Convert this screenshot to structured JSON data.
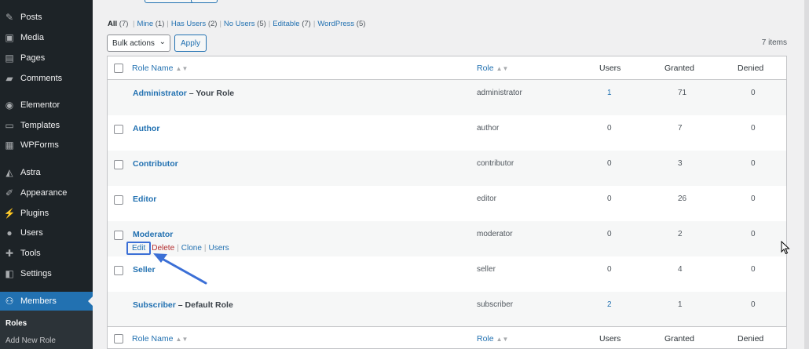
{
  "sidebar": {
    "items": [
      {
        "label": "Posts",
        "icon": "pushpin-icon",
        "glyph": "✎"
      },
      {
        "label": "Media",
        "icon": "media-icon",
        "glyph": "▣"
      },
      {
        "label": "Pages",
        "icon": "pages-icon",
        "glyph": "▤"
      },
      {
        "label": "Comments",
        "icon": "comment-icon",
        "glyph": "▰"
      },
      {
        "label": "Elementor",
        "icon": "elementor-icon",
        "glyph": "◉"
      },
      {
        "label": "Templates",
        "icon": "folder-icon",
        "glyph": "▭"
      },
      {
        "label": "WPForms",
        "icon": "wpforms-icon",
        "glyph": "▦"
      },
      {
        "label": "Astra",
        "icon": "astra-icon",
        "glyph": "◭"
      },
      {
        "label": "Appearance",
        "icon": "brush-icon",
        "glyph": "✐"
      },
      {
        "label": "Plugins",
        "icon": "plug-icon",
        "glyph": "⚡"
      },
      {
        "label": "Users",
        "icon": "user-icon",
        "glyph": "●"
      },
      {
        "label": "Tools",
        "icon": "wrench-icon",
        "glyph": "✚"
      },
      {
        "label": "Settings",
        "icon": "settings-icon",
        "glyph": "◧"
      },
      {
        "label": "Members",
        "icon": "members-icon",
        "glyph": "⚇"
      }
    ],
    "submenu": [
      "Roles",
      "Add New Role"
    ]
  },
  "filters": {
    "all": {
      "label": "All",
      "count": "(7)"
    },
    "items": [
      {
        "label": "Mine",
        "count": "(1)"
      },
      {
        "label": "Has Users",
        "count": "(2)"
      },
      {
        "label": "No Users",
        "count": "(5)"
      },
      {
        "label": "Editable",
        "count": "(7)"
      },
      {
        "label": "WordPress",
        "count": "(5)"
      }
    ],
    "separator": "|"
  },
  "toolbar": {
    "bulk_actions": "Bulk actions",
    "apply": "Apply",
    "items_count": "7 items"
  },
  "table": {
    "columns": {
      "role_name": "Role Name",
      "role": "Role",
      "users": "Users",
      "granted": "Granted",
      "denied": "Denied"
    },
    "sort_indicator": "▲▼",
    "rows": [
      {
        "name": "Administrator",
        "suffix": " – Your Role",
        "role": "administrator",
        "users": "1",
        "granted": "71",
        "denied": "0",
        "checkbox": false,
        "users_link": true
      },
      {
        "name": "Author",
        "suffix": "",
        "role": "author",
        "users": "0",
        "granted": "7",
        "denied": "0",
        "checkbox": true,
        "users_link": false
      },
      {
        "name": "Contributor",
        "suffix": "",
        "role": "contributor",
        "users": "0",
        "granted": "3",
        "denied": "0",
        "checkbox": true,
        "users_link": false
      },
      {
        "name": "Editor",
        "suffix": "",
        "role": "editor",
        "users": "0",
        "granted": "26",
        "denied": "0",
        "checkbox": true,
        "users_link": false
      },
      {
        "name": "Moderator",
        "suffix": "",
        "role": "moderator",
        "users": "0",
        "granted": "2",
        "denied": "0",
        "checkbox": true,
        "users_link": false
      },
      {
        "name": "Seller",
        "suffix": "",
        "role": "seller",
        "users": "0",
        "granted": "4",
        "denied": "0",
        "checkbox": true,
        "users_link": false
      },
      {
        "name": "Subscriber",
        "suffix": " – Default Role",
        "role": "subscriber",
        "users": "2",
        "granted": "1",
        "denied": "0",
        "checkbox": false,
        "users_link": true
      }
    ],
    "row_actions": {
      "edit": "Edit",
      "delete": "Delete",
      "clone": "Clone",
      "users": "Users"
    }
  },
  "colors": {
    "sidebar_bg": "#1d2327",
    "accent": "#2271b1",
    "annotation": "#3b6fd6",
    "delete": "#b32d2e"
  }
}
